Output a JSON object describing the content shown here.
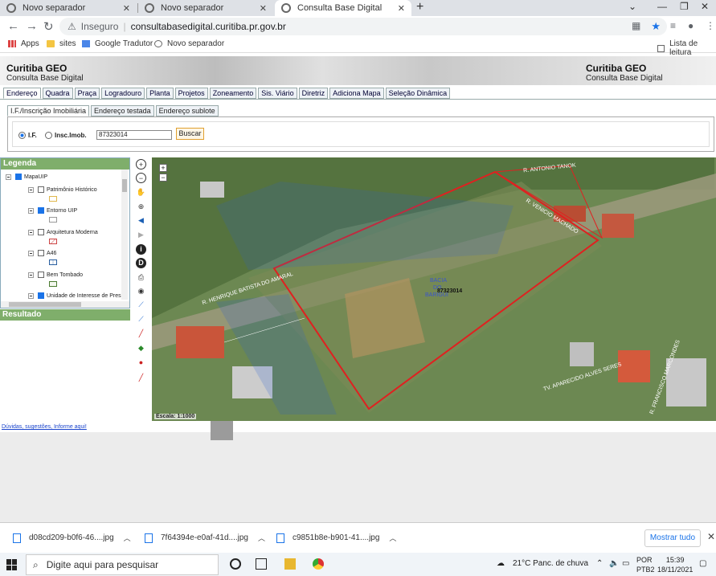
{
  "browser": {
    "tabs": [
      {
        "title": "Novo separador"
      },
      {
        "title": "Novo separador"
      },
      {
        "title": "Consulta Base Digital"
      }
    ],
    "security_label": "Inseguro",
    "url": "consultabasedigital.curitiba.pr.gov.br",
    "bookmarks": [
      "Apps",
      "sites",
      "Google Tradutor",
      "Novo separador"
    ],
    "reading_list": "Lista de leitura"
  },
  "site": {
    "title": "Curitiba GEO",
    "subtitle": "Consulta Base Digital",
    "main_tabs": [
      "Endereço",
      "Quadra",
      "Praça",
      "Logradouro",
      "Planta",
      "Projetos",
      "Zoneamento",
      "Sis. Viário",
      "Diretriz",
      "Adiciona Mapa",
      "Seleção Dinâmica"
    ],
    "sub_tabs": [
      "I.F./Inscrição Imobiliária",
      "Endereço testada",
      "Endereço sublote"
    ],
    "radio_if": "I.F.",
    "radio_insc": "Insc.Imob.",
    "if_value": "87323014",
    "search_button": "Buscar"
  },
  "legend": {
    "title": "Legenda",
    "root": "MapaUIP",
    "items": [
      {
        "label": "Patrimônio Histórico",
        "checked": false
      },
      {
        "label": "Entorno UIP",
        "checked": true
      },
      {
        "label": "Arquitetura Moderna",
        "checked": false
      },
      {
        "label": "A46",
        "checked": false
      },
      {
        "label": "Bem Tombado",
        "checked": false
      },
      {
        "label": "Unidade de Interesse de Pres",
        "checked": true
      }
    ]
  },
  "resultado": "Resultado",
  "map": {
    "lot_id": "87323014",
    "area_label_1": "BACIA",
    "area_label_2": "DO",
    "area_label_3": "BARIGUI",
    "streets": [
      "R. ANTONIO TANOK",
      "R. VENICIO MACHADO",
      "R. HENRIQUE BATISTA DO AMARAL",
      "TV. APARECIDO ALVES SERES",
      "R. FRANCISCO MARCONDES"
    ],
    "scale": "Escala: 1:1000"
  },
  "footer_link": "Dúvidas, sugestões, Informe aqui!",
  "downloads": [
    {
      "name": "d08cd209-b0f6-46....jpg"
    },
    {
      "name": "7f64394e-e0af-41d....jpg"
    },
    {
      "name": "c9851b8e-b901-41....jpg"
    }
  ],
  "show_all": "Mostrar tudo",
  "taskbar": {
    "search_placeholder": "Digite aqui para pesquisar",
    "weather": "21°C  Panc. de chuva",
    "lang_1": "POR",
    "lang_2": "PTB2",
    "time": "15:39",
    "date": "18/11/2021"
  }
}
